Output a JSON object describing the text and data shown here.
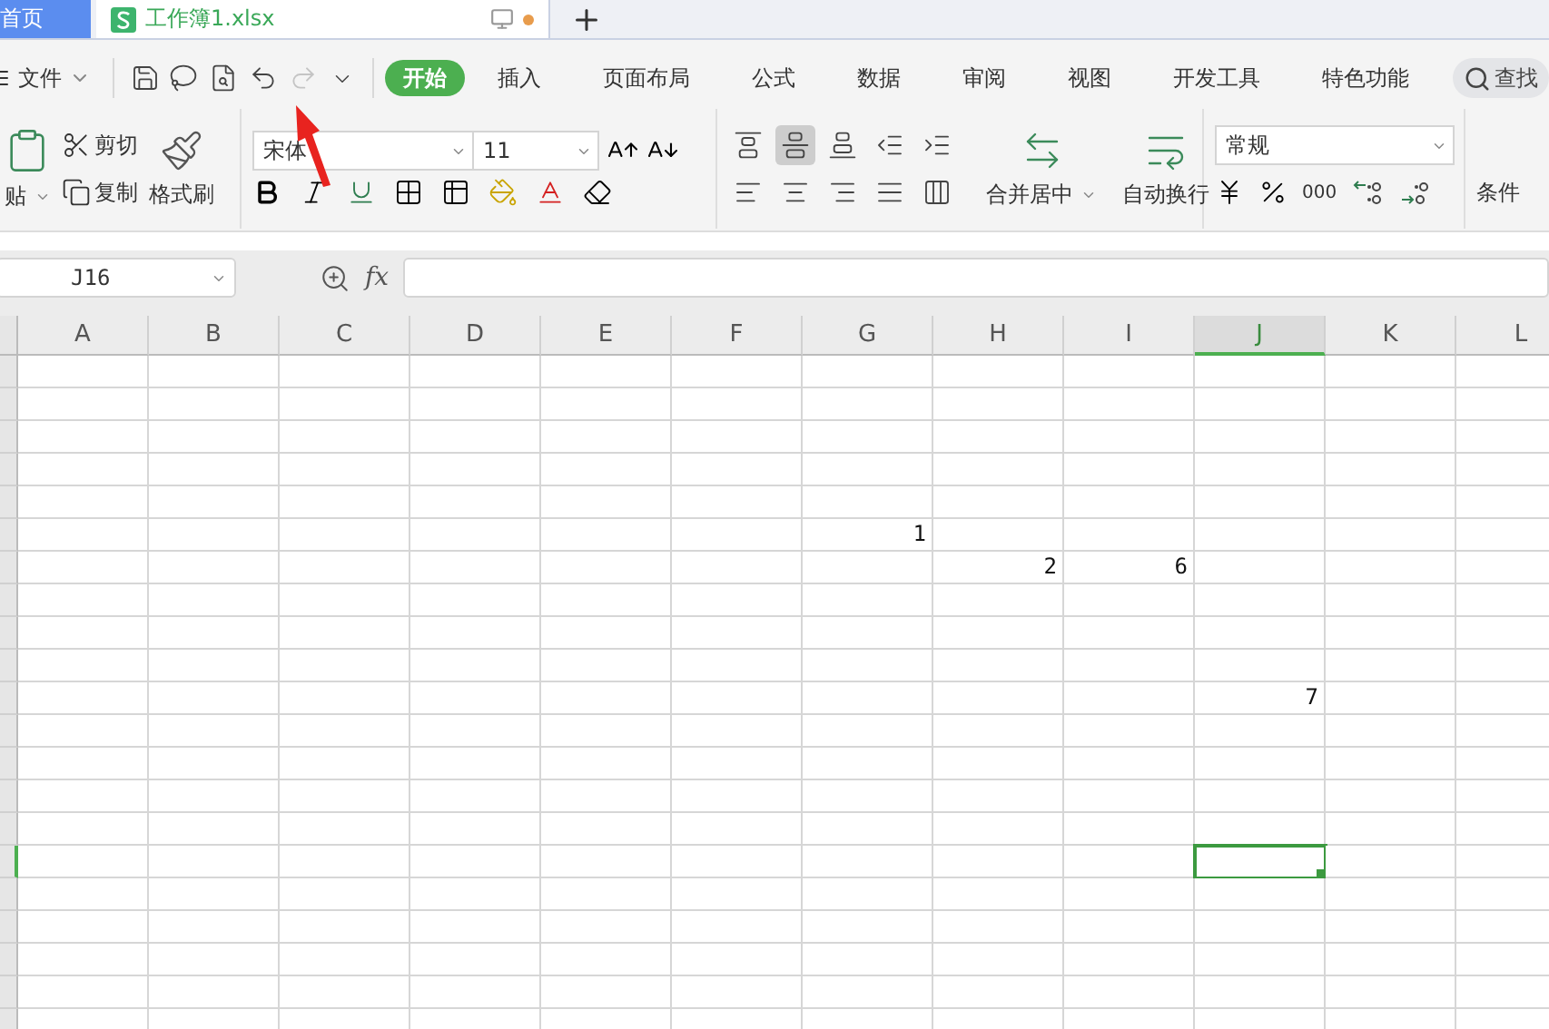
{
  "title_tabs": [
    {
      "label": "首页",
      "kind": "home",
      "selected": false
    },
    {
      "label": "工作簿1.xlsx",
      "kind": "file",
      "selected": true,
      "unsaved": true
    }
  ],
  "menu": {
    "file_label": "文件",
    "quick_access": [
      {
        "kind": "save",
        "disabled": false
      },
      {
        "kind": "lasso",
        "disabled": false
      },
      {
        "kind": "preview",
        "disabled": false
      },
      {
        "kind": "undo",
        "disabled": false
      },
      {
        "kind": "redo",
        "disabled": true
      },
      {
        "kind": "more",
        "disabled": false
      }
    ]
  },
  "ribbon_tabs": [
    {
      "label": "开始",
      "selected": true
    },
    {
      "label": "插入",
      "selected": false
    },
    {
      "label": "页面布局",
      "selected": false
    },
    {
      "label": "公式",
      "selected": false
    },
    {
      "label": "数据",
      "selected": false
    },
    {
      "label": "审阅",
      "selected": false
    },
    {
      "label": "视图",
      "selected": false
    },
    {
      "label": "开发工具",
      "selected": false
    },
    {
      "label": "特色功能",
      "selected": false
    }
  ],
  "search": "查找",
  "ribbon": {
    "paste": "贴",
    "cut": "剪切",
    "copy": "复制",
    "format_painter": "格式刷",
    "font": "宋体",
    "font_size": "11",
    "align_top_row": [
      {
        "kind": "top",
        "selected": false
      },
      {
        "kind": "middle",
        "selected": true
      },
      {
        "kind": "bottom",
        "selected": false
      },
      {
        "kind": "outdent",
        "selected": false
      },
      {
        "kind": "indent",
        "selected": false
      }
    ],
    "align_bottom_row": [
      {
        "kind": "left",
        "selected": false
      },
      {
        "kind": "center",
        "selected": false
      },
      {
        "kind": "right",
        "selected": false
      },
      {
        "kind": "justify",
        "selected": false
      },
      {
        "kind": "distributed",
        "selected": false
      }
    ],
    "merge": "合并居中",
    "wrap": "自动换行",
    "number_format": "常规",
    "thousands": "000",
    "conditional": "条件"
  },
  "formula_bar": {
    "name_box": "J16",
    "fx": "fx"
  },
  "sheet": {
    "columns": [
      {
        "label": "A",
        "selected": false
      },
      {
        "label": "B",
        "selected": false
      },
      {
        "label": "C",
        "selected": false
      },
      {
        "label": "D",
        "selected": false
      },
      {
        "label": "E",
        "selected": false
      },
      {
        "label": "F",
        "selected": false
      },
      {
        "label": "G",
        "selected": false
      },
      {
        "label": "H",
        "selected": false
      },
      {
        "label": "I",
        "selected": false
      },
      {
        "label": "J",
        "selected": true
      },
      {
        "label": "K",
        "selected": false
      },
      {
        "label": "L",
        "selected": false
      }
    ],
    "rows": [
      {
        "selected": false,
        "cells": {}
      },
      {
        "selected": false,
        "cells": {}
      },
      {
        "selected": false,
        "cells": {}
      },
      {
        "selected": false,
        "cells": {}
      },
      {
        "selected": false,
        "cells": {}
      },
      {
        "selected": false,
        "cells": {
          "G": "1"
        }
      },
      {
        "selected": false,
        "cells": {
          "H": "2",
          "I": "6"
        }
      },
      {
        "selected": false,
        "cells": {}
      },
      {
        "selected": false,
        "cells": {}
      },
      {
        "selected": false,
        "cells": {}
      },
      {
        "selected": false,
        "cells": {
          "J": "7"
        }
      },
      {
        "selected": false,
        "cells": {}
      },
      {
        "selected": false,
        "cells": {}
      },
      {
        "selected": false,
        "cells": {}
      },
      {
        "selected": false,
        "cells": {}
      },
      {
        "selected": true,
        "cells": {}
      },
      {
        "selected": false,
        "cells": {}
      },
      {
        "selected": false,
        "cells": {}
      },
      {
        "selected": false,
        "cells": {}
      },
      {
        "selected": false,
        "cells": {}
      },
      {
        "selected": false,
        "cells": {}
      }
    ]
  }
}
